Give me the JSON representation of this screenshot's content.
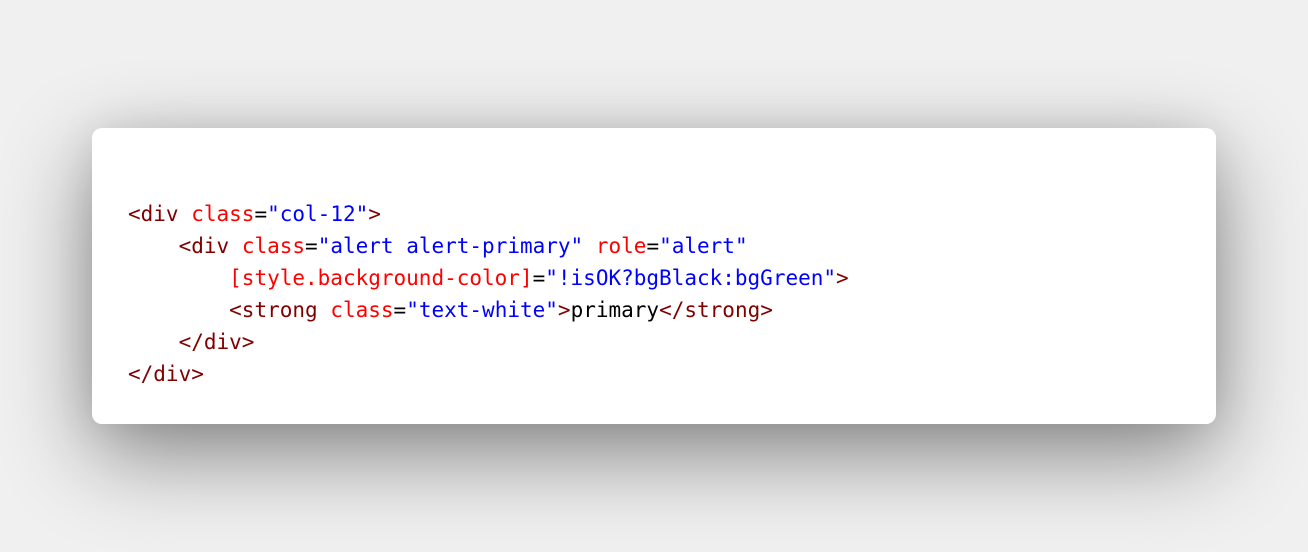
{
  "code": {
    "lines": [
      {
        "indent": "",
        "tokens": [
          {
            "type": "tag",
            "text": "<div"
          },
          {
            "type": "plain",
            "text": " "
          },
          {
            "type": "attr",
            "text": "class"
          },
          {
            "type": "plain",
            "text": "="
          },
          {
            "type": "str",
            "text": "\"col-12\""
          },
          {
            "type": "tag",
            "text": ">"
          }
        ]
      },
      {
        "indent": "    ",
        "tokens": [
          {
            "type": "tag",
            "text": "<div"
          },
          {
            "type": "plain",
            "text": " "
          },
          {
            "type": "attr",
            "text": "class"
          },
          {
            "type": "plain",
            "text": "="
          },
          {
            "type": "str",
            "text": "\"alert alert-primary\""
          },
          {
            "type": "plain",
            "text": " "
          },
          {
            "type": "attr",
            "text": "role"
          },
          {
            "type": "plain",
            "text": "="
          },
          {
            "type": "str",
            "text": "\"alert\""
          }
        ]
      },
      {
        "indent": "        ",
        "tokens": [
          {
            "type": "attr",
            "text": "[style.background-color]"
          },
          {
            "type": "plain",
            "text": "="
          },
          {
            "type": "str",
            "text": "\"!isOK?bgBlack:bgGreen\""
          },
          {
            "type": "tag",
            "text": ">"
          }
        ]
      },
      {
        "indent": "        ",
        "tokens": [
          {
            "type": "tag",
            "text": "<strong"
          },
          {
            "type": "plain",
            "text": " "
          },
          {
            "type": "attr",
            "text": "class"
          },
          {
            "type": "plain",
            "text": "="
          },
          {
            "type": "str",
            "text": "\"text-white\""
          },
          {
            "type": "tag",
            "text": ">"
          },
          {
            "type": "plain",
            "text": "primary"
          },
          {
            "type": "tag",
            "text": "</strong>"
          }
        ]
      },
      {
        "indent": "    ",
        "tokens": [
          {
            "type": "tag",
            "text": "</div>"
          }
        ]
      },
      {
        "indent": "",
        "tokens": [
          {
            "type": "tag",
            "text": "</div>"
          }
        ]
      }
    ]
  },
  "colors": {
    "background": "#f0f0f0",
    "card": "#ffffff",
    "tag": "#800000",
    "attribute": "#ff0000",
    "string": "#0000ff",
    "plain": "#000000"
  }
}
